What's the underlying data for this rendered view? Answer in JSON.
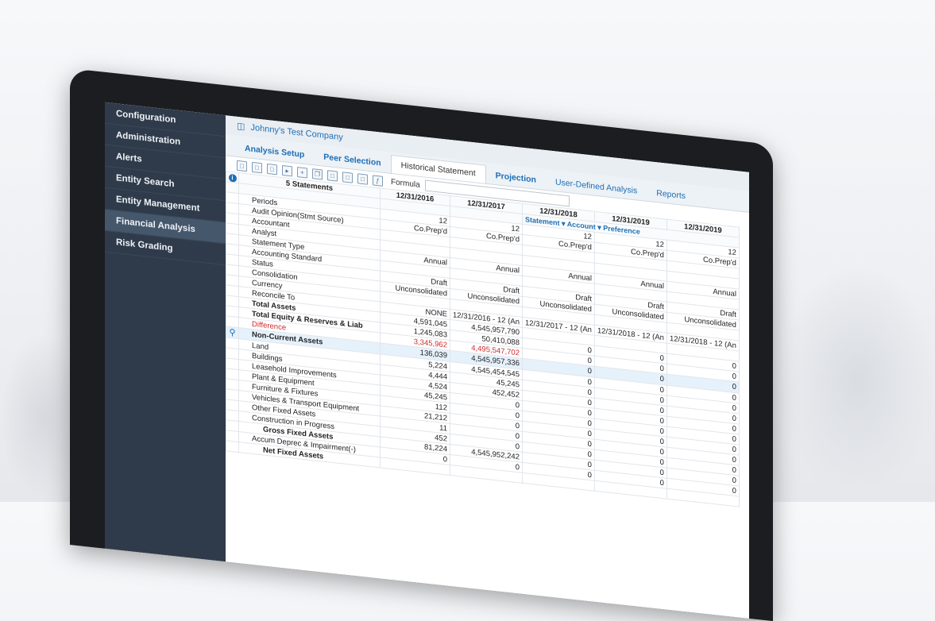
{
  "sidebar": {
    "items": [
      {
        "label": "Configuration"
      },
      {
        "label": "Administration"
      },
      {
        "label": "Alerts"
      },
      {
        "label": "Entity Search"
      },
      {
        "label": "Entity Management"
      },
      {
        "label": "Financial Analysis"
      },
      {
        "label": "Risk Grading"
      }
    ]
  },
  "header": {
    "company": "Johnny's Test Company"
  },
  "tabs": [
    {
      "label": "Analysis Setup"
    },
    {
      "label": "Peer Selection"
    },
    {
      "label": "Historical Statement"
    },
    {
      "label": "Projection"
    },
    {
      "label": "User-Defined Analysis"
    },
    {
      "label": "Reports"
    }
  ],
  "toolbar": {
    "formula_label": "Formula"
  },
  "grid": {
    "statements_header": "5 Statements",
    "columns": [
      "12/31/2016",
      "12/31/2017",
      "12/31/2018",
      "12/31/2019",
      "12/31/2019"
    ],
    "links": [
      "Statement",
      "Account",
      "Preference"
    ],
    "rows": [
      {
        "label": "Periods",
        "cells": [
          "12",
          "12",
          "12",
          "12",
          "12"
        ]
      },
      {
        "label": "Audit Opinion(Stmt Source)",
        "cells": [
          "Co.Prep'd",
          "Co.Prep'd",
          "Co.Prep'd",
          "Co.Prep'd",
          "Co.Prep'd"
        ]
      },
      {
        "label": "Accountant",
        "cells": [
          "",
          "",
          "",
          "",
          ""
        ]
      },
      {
        "label": "Analyst",
        "cells": [
          "",
          "",
          "",
          "",
          ""
        ]
      },
      {
        "label": "Statement Type",
        "cells": [
          "Annual",
          "Annual",
          "Annual",
          "Annual",
          "Annual"
        ]
      },
      {
        "label": "Accounting Standard",
        "cells": [
          "",
          "",
          "",
          "",
          ""
        ]
      },
      {
        "label": "Status",
        "cells": [
          "Draft",
          "Draft",
          "Draft",
          "Draft",
          "Draft"
        ]
      },
      {
        "label": "Consolidation",
        "cells": [
          "Unconsolidated",
          "Unconsolidated",
          "Unconsolidated",
          "Unconsolidated",
          "Unconsolidated"
        ]
      },
      {
        "label": "Currency",
        "cells": [
          "",
          "",
          "",
          "",
          ""
        ]
      },
      {
        "label": "Reconcile To",
        "cells": [
          "NONE",
          "12/31/2016 - 12 (An",
          "12/31/2017 - 12 (An",
          "12/31/2018 - 12 (An",
          "12/31/2018 - 12 (An"
        ]
      },
      {
        "label": "Total Assets",
        "cells": [
          "4,591,045",
          "4,545,957,790",
          "",
          "",
          ""
        ]
      },
      {
        "label": "Total Equity & Reserves & Liab",
        "cells": [
          "1,245,083",
          "50,410,088",
          "0",
          "0",
          "0"
        ]
      },
      {
        "label": "Difference",
        "cells": [
          "3,345,962",
          "4,495,547,702",
          "0",
          "0",
          "0"
        ]
      },
      {
        "label": "Non-Current Assets",
        "cells": [
          "136,039",
          "4,545,957,336",
          "0",
          "0",
          "0"
        ]
      },
      {
        "label": "Land",
        "cells": [
          "5,224",
          "4,545,454,545",
          "0",
          "0",
          "0"
        ]
      },
      {
        "label": "Buildings",
        "cells": [
          "4,444",
          "45,245",
          "0",
          "0",
          "0"
        ]
      },
      {
        "label": "Leasehold Improvements",
        "cells": [
          "4,524",
          "452,452",
          "0",
          "0",
          "0"
        ]
      },
      {
        "label": "Plant & Equipment",
        "cells": [
          "45,245",
          "0",
          "0",
          "0",
          "0"
        ]
      },
      {
        "label": "Furniture & Fixtures",
        "cells": [
          "112",
          "0",
          "0",
          "0",
          "0"
        ]
      },
      {
        "label": "Vehicles & Transport Equipment",
        "cells": [
          "21,212",
          "0",
          "0",
          "0",
          "0"
        ]
      },
      {
        "label": "Other Fixed Assets",
        "cells": [
          "11",
          "0",
          "0",
          "0",
          "0"
        ]
      },
      {
        "label": "Construction in Progress",
        "cells": [
          "452",
          "0",
          "0",
          "0",
          "0"
        ]
      },
      {
        "label": "Gross Fixed Assets",
        "cells": [
          "81,224",
          "4,545,952,242",
          "0",
          "0",
          "0"
        ]
      },
      {
        "label": "Accum Deprec & Impairment(-)",
        "cells": [
          "0",
          "0",
          "0",
          "0",
          "0"
        ]
      },
      {
        "label": "Net Fixed Assets",
        "cells": [
          "",
          "",
          "",
          "",
          ""
        ]
      }
    ]
  }
}
